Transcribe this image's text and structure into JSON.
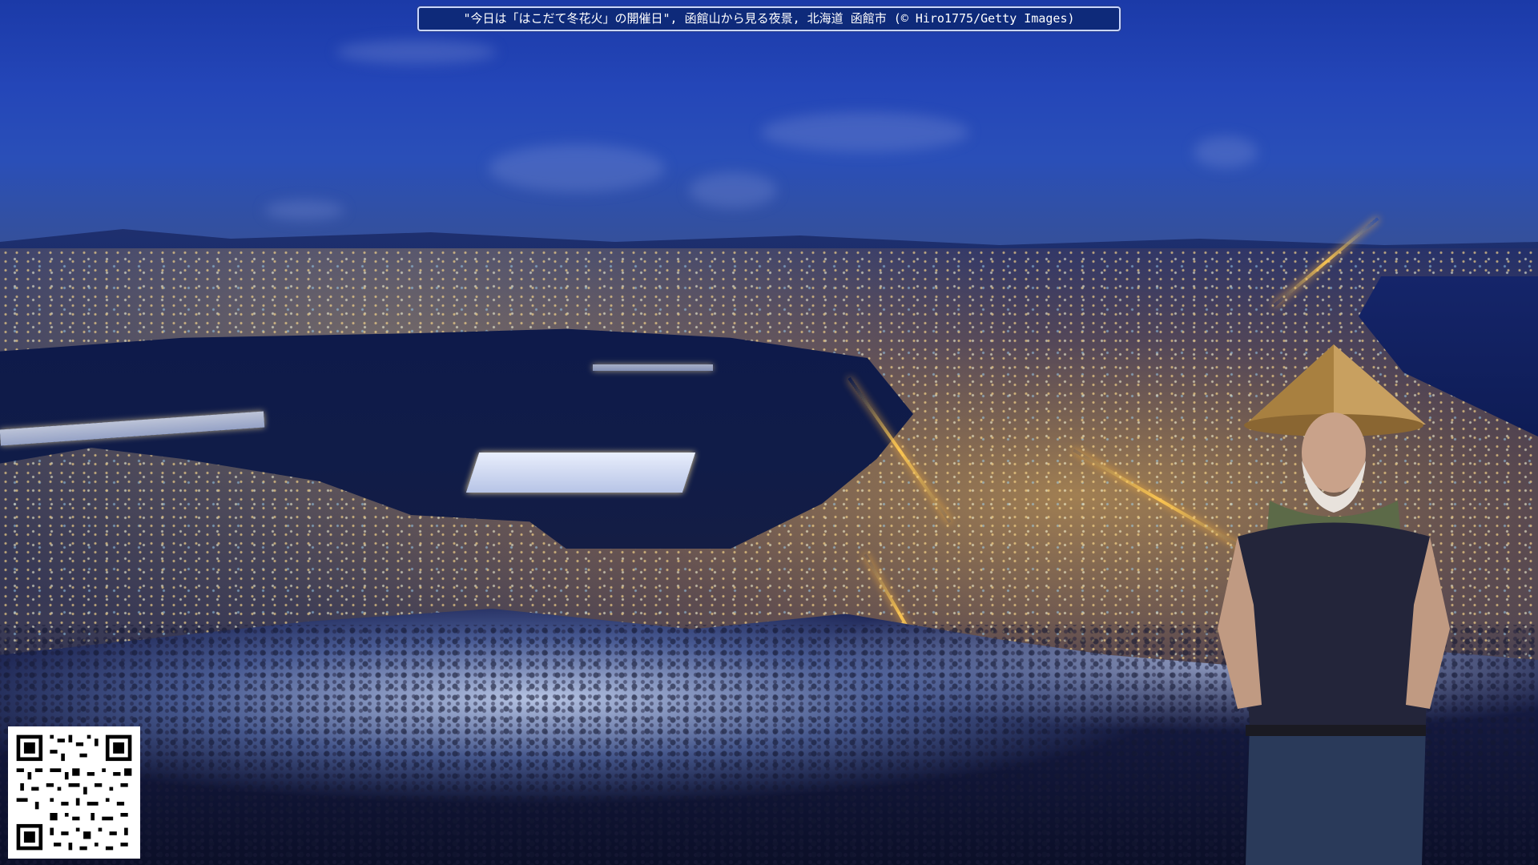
{
  "caption": {
    "text": "\"今日は「はこだて冬花火」の開催日\", 函館山から見る夜景, 北海道 函館市 (© Hiro1775/Getty Images)"
  },
  "scene": {
    "description_icon": "night-city-landscape",
    "colors": {
      "sky": "#2446b8",
      "city_lights": "#ffc850",
      "water": "#101c48",
      "snow": "#dfe8ff",
      "caption_bg": "#0e2a7a"
    }
  },
  "qr": {
    "icon": "qr-code-icon"
  },
  "person": {
    "icon": "person-with-straw-hat"
  }
}
